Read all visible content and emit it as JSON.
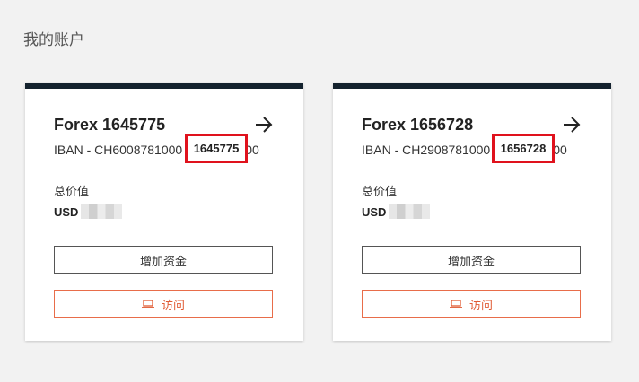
{
  "page": {
    "title": "我的账户"
  },
  "accounts": [
    {
      "title": "Forex 1645775",
      "iban_prefix": "IBAN - CH6008781000",
      "iban_suffix": "00",
      "highlighted_number": "1645775",
      "value_label": "总价值",
      "currency": "USD",
      "add_funds_label": "增加资金",
      "visit_label": "访问",
      "icons": {
        "arrow": "arrow-right-icon",
        "visit": "laptop-icon"
      }
    },
    {
      "title": "Forex 1656728",
      "iban_prefix": "IBAN - CH2908781000",
      "iban_suffix": "00",
      "highlighted_number": "1656728",
      "value_label": "总价值",
      "currency": "USD",
      "add_funds_label": "增加资金",
      "visit_label": "访问",
      "icons": {
        "arrow": "arrow-right-icon",
        "visit": "laptop-icon"
      }
    }
  ],
  "colors": {
    "card_top_border": "#14222e",
    "highlight_border": "#e0121d",
    "visit_accent": "#e05a33"
  }
}
